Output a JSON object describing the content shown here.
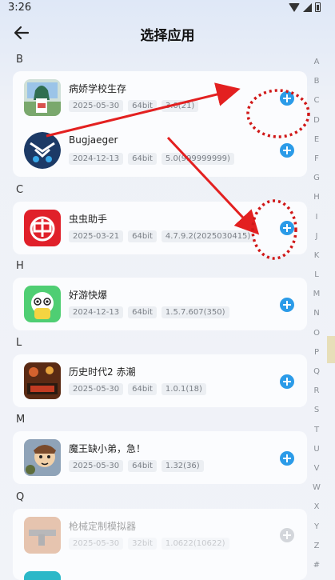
{
  "status_bar": {
    "time": "3:26"
  },
  "header": {
    "title": "选择应用"
  },
  "sections": [
    {
      "letter": "B",
      "apps": [
        {
          "name": "病娇学校生存",
          "date": "2025-05-30",
          "arch": "64bit",
          "version": "3.0(21)"
        },
        {
          "name": "Bugjaeger",
          "date": "2024-12-13",
          "arch": "64bit",
          "version": "5.0(999999999)"
        }
      ]
    },
    {
      "letter": "C",
      "apps": [
        {
          "name": "虫虫助手",
          "date": "2025-03-21",
          "arch": "64bit",
          "version": "4.7.9.2(2025030415)"
        }
      ]
    },
    {
      "letter": "H",
      "apps": [
        {
          "name": "好游快爆",
          "date": "2024-12-13",
          "arch": "64bit",
          "version": "1.5.7.607(350)"
        }
      ]
    },
    {
      "letter": "L",
      "apps": [
        {
          "name": "历史时代2 赤潮",
          "date": "2025-05-30",
          "arch": "64bit",
          "version": "1.0.1(18)"
        }
      ]
    },
    {
      "letter": "M",
      "apps": [
        {
          "name": "魔王缺小弟，急！",
          "date": "2025-05-30",
          "arch": "64bit",
          "version": "1.32(36)"
        }
      ]
    },
    {
      "letter": "Q",
      "apps": [
        {
          "name": "枪械定制模拟器",
          "date": "2025-05-30",
          "arch": "32bit",
          "version": "1.0622(10622)",
          "disabled": true
        }
      ]
    }
  ],
  "index_letters": [
    "A",
    "B",
    "C",
    "D",
    "E",
    "F",
    "G",
    "H",
    "I",
    "J",
    "K",
    "L",
    "M",
    "N",
    "O",
    "P",
    "Q",
    "R",
    "S",
    "T",
    "U",
    "V",
    "W",
    "X",
    "Y",
    "Z",
    "#"
  ],
  "colors": {
    "accent": "#2b9be8",
    "annotation": "#e32020"
  },
  "icons": [
    "back-arrow-icon",
    "wifi-icon",
    "signal-icon",
    "battery-icon",
    "add-icon"
  ]
}
